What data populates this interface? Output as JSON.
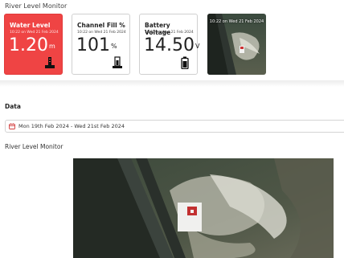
{
  "app": {
    "title": "River Level Monitor"
  },
  "cards": [
    {
      "label": "Water Level",
      "time": "10:22 on Wed 21 Feb 2024",
      "value": "1.20",
      "unit": "m",
      "icon": "water-gauge-icon",
      "color": "#ef4444"
    },
    {
      "label": "Channel Fill %",
      "time": "10:22 on Wed 21 Feb 2024",
      "value": "101",
      "unit": "%",
      "icon": "channel-fill-icon"
    },
    {
      "label": "Battery Voltage",
      "time": "10:22 on Wed 21 Feb 2024",
      "value": "14.50",
      "unit": "V",
      "icon": "battery-icon"
    }
  ],
  "camera": {
    "timestamp": "10:22 on Wed 21 Feb 2024"
  },
  "data_section": {
    "heading": "Data",
    "date_range": "Mon 19th Feb 2024 - Wed 21st Feb 2024",
    "calendar_icon": "calendar-icon"
  },
  "monitor_section": {
    "heading": "River Level Monitor"
  }
}
